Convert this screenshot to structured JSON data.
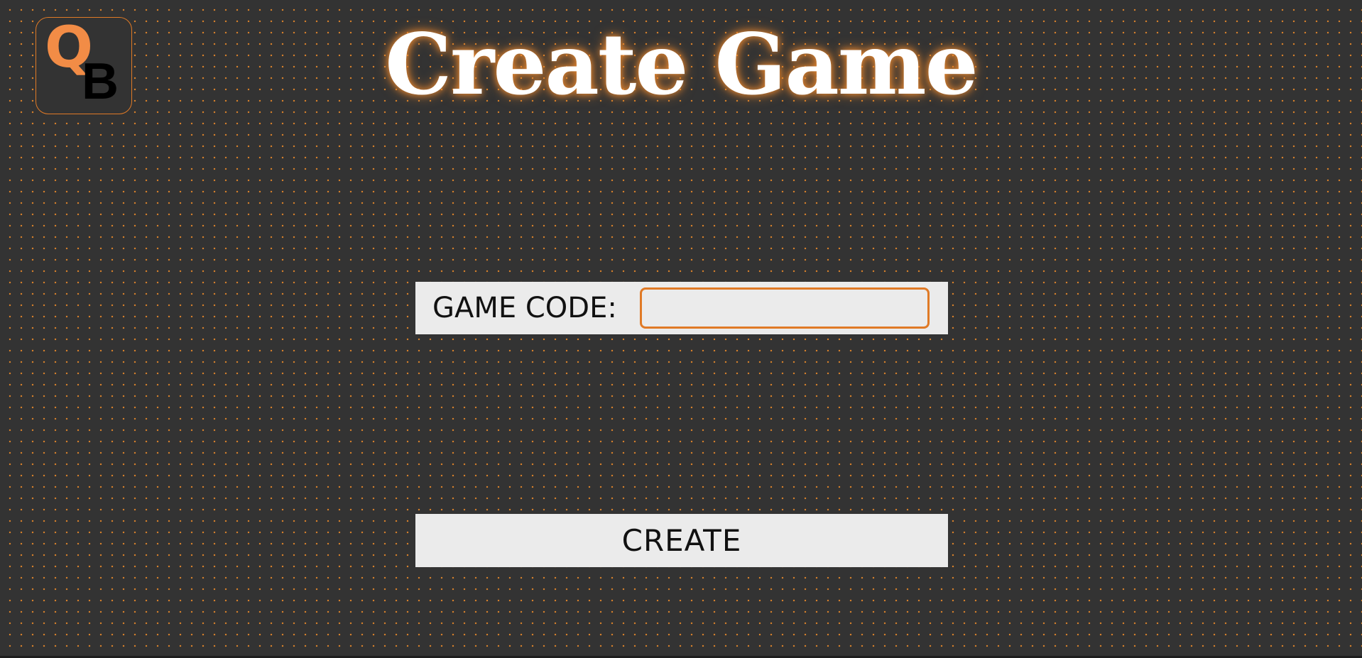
{
  "logo": {
    "letter_top": "Q",
    "letter_bottom": "B"
  },
  "header": {
    "title": "Create Game"
  },
  "form": {
    "game_code_label": "GAME CODE:",
    "game_code_value": "",
    "game_code_placeholder": ""
  },
  "actions": {
    "create_label": "CREATE"
  },
  "colors": {
    "background": "#333333",
    "accent": "#e07a26",
    "logo_q": "#f28c46",
    "panel": "#ebebeb"
  }
}
